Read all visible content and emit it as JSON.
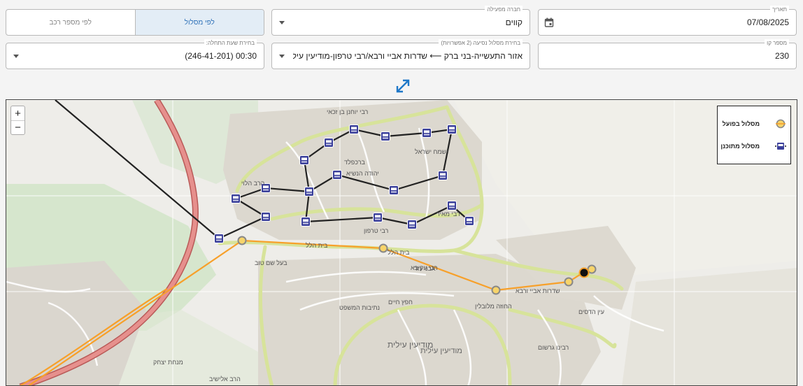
{
  "filters": {
    "toggle": {
      "by_route": "לפי מסלול",
      "by_vehicle": "לפי מספר רכב"
    },
    "date": {
      "label": "תאריך",
      "value": "07/08/2025"
    },
    "operator": {
      "label": "חברה מפעילה",
      "value": "קווים"
    },
    "line_number": {
      "label": "מספר קו",
      "value": "230"
    },
    "route_choice": {
      "label": "בחירת מסלול נסיעה (2 אפשרויות)",
      "value": "אזור התעשייה-בני ברק ⟵ שדרות אביי ורבא/רבי טרפון-מודיעין עילית  (נס..."
    },
    "start_time": {
      "label": "בחירת שעת התחלה:",
      "value": "00:30 (246-41-201)"
    }
  },
  "map": {
    "zoom_in": "+",
    "zoom_out": "−",
    "legend": {
      "actual": "מסלול בפועל",
      "planned": "מסלול מתוכנן"
    },
    "colors": {
      "actual": "#f7a02a",
      "planned": "#222222",
      "stop": "#3a3f9a",
      "highway": "#e07a78"
    },
    "labels": {
      "neighborhood": "ברכפלד",
      "city": "מודיעין עילית",
      "city2": "מודיעין עילית",
      "street1": "בית הלל",
      "street2": "בית הלל",
      "street3": "אבני נזר",
      "street4": "שדרות אביי ורבא",
      "street5": "רבי טרפון",
      "street6": "ישמח ישראל",
      "street7": "יהודה הנשיא",
      "street8": "רבי מאיר",
      "street9": "נתיבות המשפט",
      "street10": "החוזה מלובלין",
      "street11": "חפץ חיים",
      "street12": "הרב הלוי",
      "street13": "בעל שם טוב",
      "street14": "רבי עקיבא",
      "street15": "רבי יוחנן בן זכאי",
      "street16": "מנחת יצחק",
      "street17": "רבינו גרשום",
      "street18": "הרב אלישיב",
      "street19": "עין הדסים"
    }
  }
}
